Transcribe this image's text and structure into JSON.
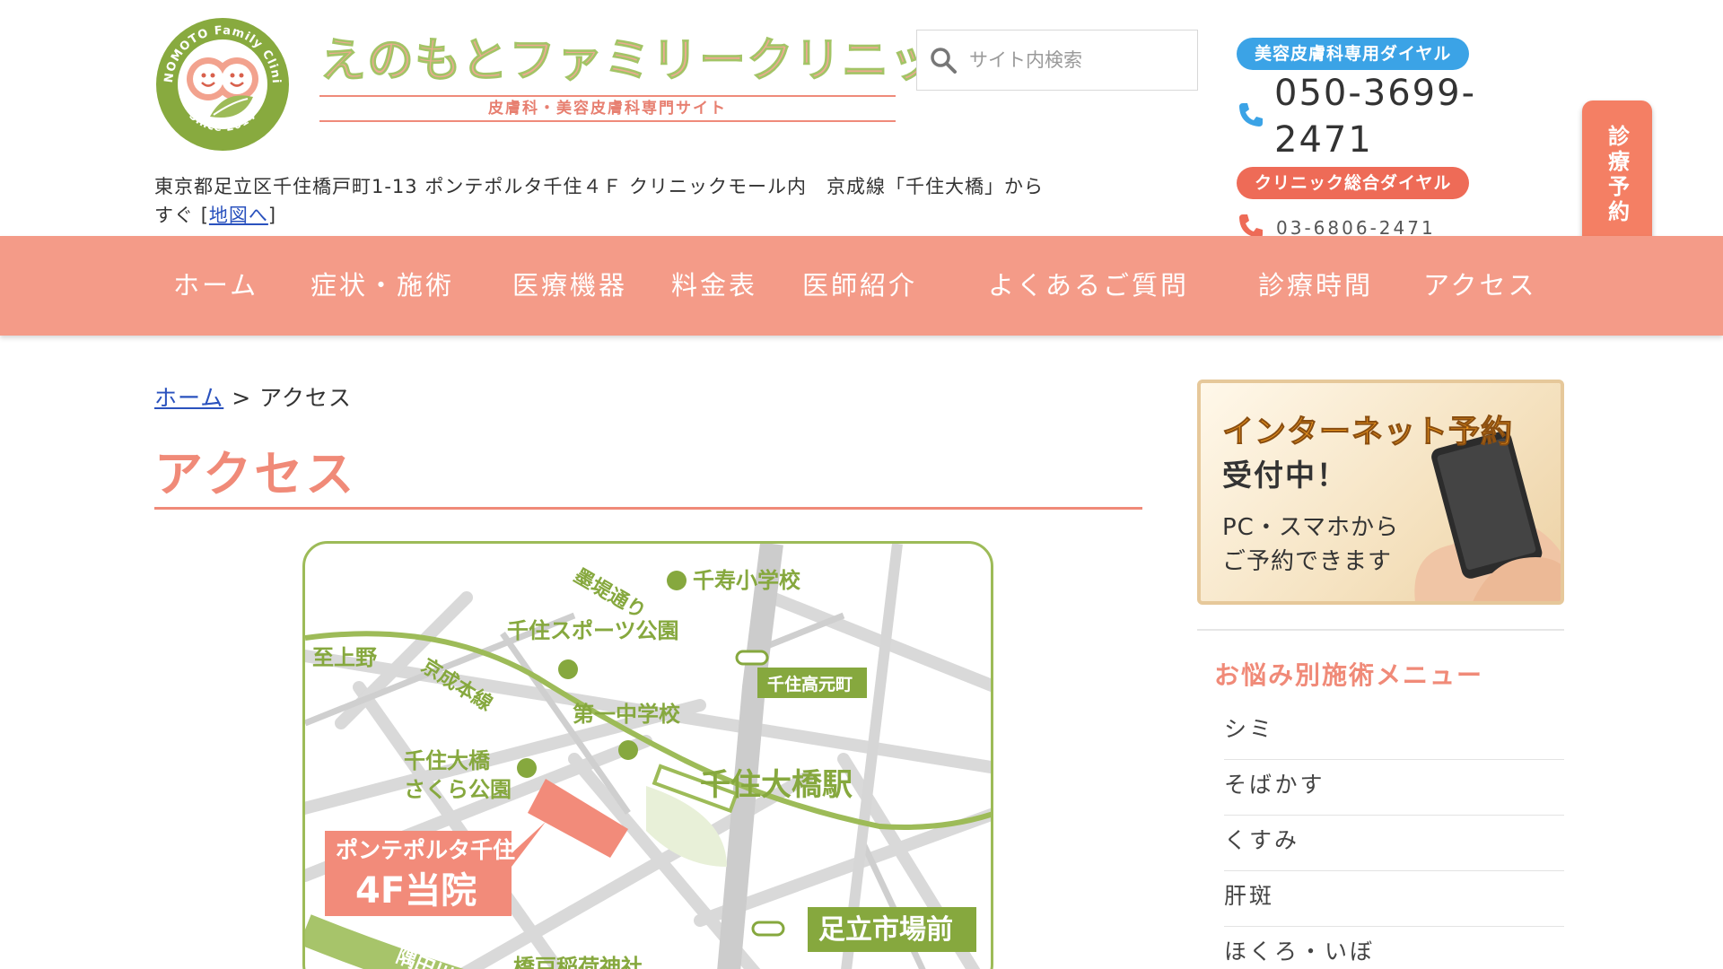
{
  "header": {
    "logo": {
      "ring_text_top": "ENOMOTO Family Clinic",
      "ring_text_bottom": "Since 2014"
    },
    "brand_title": "えのもとファミリークリニック",
    "brand_subtitle": "皮膚科・美容皮膚科専門サイト",
    "search_placeholder": "サイト内検索",
    "address": "東京都足立区千住橋戸町1-13 ポンテポルタ千住４Ｆ クリニックモール内　京成線「千住大橋」からすぐ ",
    "map_link_label": "地図へ",
    "address_bracket_open": "[",
    "address_bracket_close": "]",
    "contact": {
      "beauty_dial_label": "美容皮膚科専用ダイヤル",
      "beauty_dial_number": "050-3699-2471",
      "clinic_dial_label": "クリニック総合ダイヤル",
      "clinic_dial_number": "03-6806-2471"
    },
    "reserve_button": "診療予約"
  },
  "nav": {
    "items": [
      {
        "label": "ホーム"
      },
      {
        "label": "症状・施術"
      },
      {
        "label": "医療機器"
      },
      {
        "label": "料金表"
      },
      {
        "label": "医師紹介"
      },
      {
        "label": "よくあるご質問"
      },
      {
        "label": "診療時間"
      },
      {
        "label": "アクセス"
      }
    ]
  },
  "main": {
    "breadcrumb": {
      "home": "ホーム",
      "separator": ">",
      "current": "アクセス"
    },
    "page_title": "アクセス",
    "map": {
      "labels": {
        "bokutei": "墨堤通り",
        "senju_elementary": "千寿小学校",
        "sports_park": "千住スポーツ公園",
        "to_ueno": "至上野",
        "keisei_line": "京成本線",
        "daiichi_junior": "第一中学校",
        "sakura_park_1": "千住大橋",
        "sakura_park_2": "さくら公園",
        "station": "千住大橋駅",
        "bus_stop_1": "千住高元町",
        "bus_stop_2": "足立市場前",
        "clinic_line1": "ポンテポルタ千住",
        "clinic_line2": "4F当院",
        "shrine": "橋戸稲荷神社",
        "river": "隅田川"
      }
    }
  },
  "sidebar": {
    "banner": {
      "line1": "インターネット予約",
      "line2": "受付中！",
      "line3a": "PC・スマホから",
      "line3b": "ご予約できます"
    },
    "menu_heading": "お悩み別施術メニュー",
    "menu_items": [
      {
        "label": "シミ"
      },
      {
        "label": "そばかす"
      },
      {
        "label": "くすみ"
      },
      {
        "label": "肝斑"
      },
      {
        "label": "ほくろ・いぼ"
      }
    ]
  },
  "colors": {
    "nav_bg": "#f49b88",
    "accent": "#f08a78",
    "green": "#9dbb58",
    "blue_pill": "#3ba3e6",
    "red_pill": "#ee6b57"
  }
}
